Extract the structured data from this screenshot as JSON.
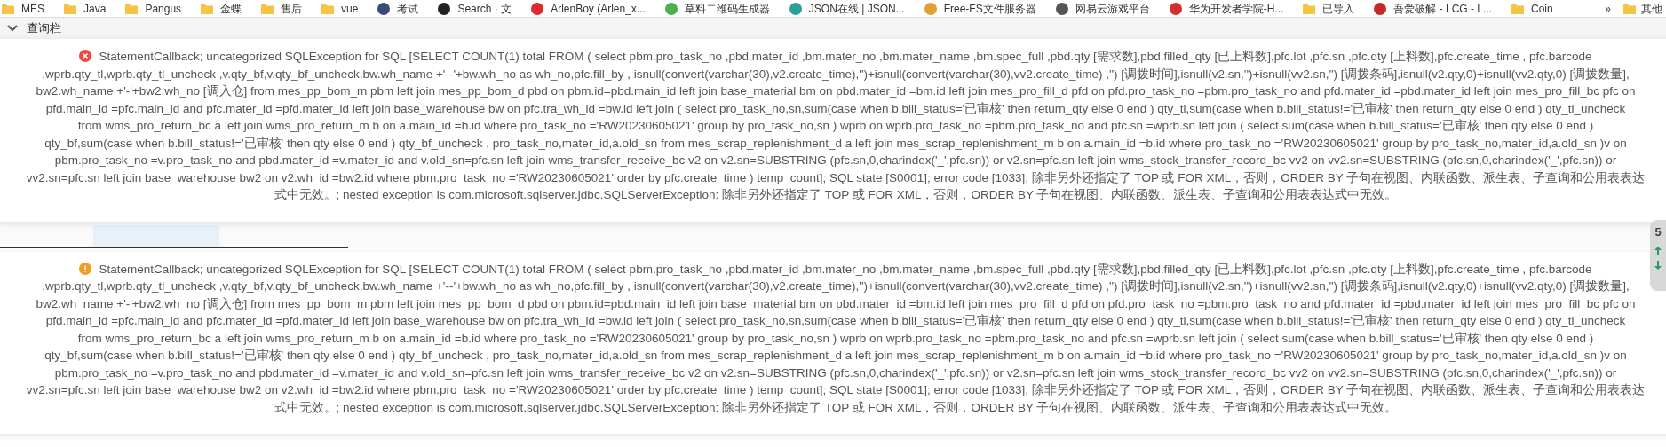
{
  "bookmarks": [
    {
      "label": "MES",
      "kind": "folder"
    },
    {
      "label": "Java",
      "kind": "folder"
    },
    {
      "label": "Pangus",
      "kind": "folder"
    },
    {
      "label": "金蝶",
      "kind": "folder"
    },
    {
      "label": "售后",
      "kind": "folder"
    },
    {
      "label": "vue",
      "kind": "folder"
    },
    {
      "label": "考试",
      "kind": "site",
      "color": "#3b4a7a"
    },
    {
      "label": "Search · 文",
      "kind": "github"
    },
    {
      "label": "ArlenBoy (Arlen_x...",
      "kind": "site",
      "color": "#e0282e"
    },
    {
      "label": "草料二维码生成器",
      "kind": "site",
      "color": "#4caf50"
    },
    {
      "label": "JSON在线 | JSON...",
      "kind": "site",
      "color": "#2aa198"
    },
    {
      "label": "Free-FS文件服务器",
      "kind": "site",
      "color": "#e0a030"
    },
    {
      "label": "网易云游戏平台",
      "kind": "site",
      "color": "#555555"
    },
    {
      "label": "华为开发者学院-H...",
      "kind": "site",
      "color": "#d32f2f"
    },
    {
      "label": "已导入",
      "kind": "folder"
    },
    {
      "label": "吾爱破解 - LCG - L...",
      "kind": "site",
      "color": "#c62828"
    },
    {
      "label": "Coin",
      "kind": "folder"
    }
  ],
  "bookmarks_more": "»",
  "other_bookmarks": "其他",
  "panel": {
    "title": "查询栏",
    "expanded": true
  },
  "messages": [
    {
      "kind": "error",
      "lines": [
        "StatementCallback; uncategorized SQLException for SQL [SELECT COUNT(1) total FROM ( select pbm.pro_task_no ,pbd.mater_id ,bm.mater_no ,bm.mater_name ,bm.spec_full ,pbd.qty [需求数],pbd.filled_qty [已上料数],pfc.lot ,pfc.sn ,pfc.qty [上料数],pfc.create_time , pfc.barcode",
        ",wprb.qty_tl,wprb.qty_tl_uncheck ,v.qty_bf,v.qty_bf_uncheck,bw.wh_name +'--'+bw.wh_no as wh_no,pfc.fill_by , isnull(convert(varchar(30),v2.create_time),'')+isnull(convert(varchar(30),vv2.create_time) ,'') [调拨时间],isnull(v2.sn,'')+isnull(vv2.sn,'') [调拨条码],isnull(v2.qty,0)+isnull(vv2.qty,0) [调拨数量],",
        "bw2.wh_name +'-'+bw2.wh_no [调入仓] from mes_pp_bom_m pbm left join mes_pp_bom_d pbd on pbm.id=pbd.main_id left join base_material bm on pbd.mater_id =bm.id left join mes_pro_fill_d pfd on pfd.pro_task_no =pbm.pro_task_no and pfd.mater_id =pbd.mater_id left join mes_pro_fill_bc pfc on",
        "pfd.main_id =pfc.main_id and pfc.mater_id =pfd.mater_id left join base_warehouse bw on pfc.tra_wh_id =bw.id left join ( select pro_task_no,sn,sum(case when b.bill_status='已审核' then return_qty else 0 end ) qty_tl,sum(case when b.bill_status!='已审核' then return_qty else 0 end ) qty_tl_uncheck",
        "from wms_pro_return_bc a left join wms_pro_return_m b on a.main_id =b.id where pro_task_no ='RW20230605021' group by pro_task_no,sn ) wprb on wprb.pro_task_no =pbm.pro_task_no and pfc.sn =wprb.sn left join ( select sum(case when b.bill_status='已审核' then qty else 0 end )",
        "qty_bf,sum(case when b.bill_status!='已审核' then qty else 0 end ) qty_bf_uncheck , pro_task_no,mater_id,a.old_sn from mes_scrap_replenishment_d a left join mes_scrap_replenishment_m b on a.main_id =b.id where pro_task_no ='RW20230605021' group by pro_task_no,mater_id,a.old_sn )v on",
        "pbm.pro_task_no =v.pro_task_no and pbd.mater_id =v.mater_id and v.old_sn=pfc.sn left join wms_transfer_receive_bc v2 on v2.sn=SUBSTRING (pfc.sn,0,charindex('_',pfc.sn)) or v2.sn=pfc.sn left join wms_stock_transfer_record_bc vv2 on vv2.sn=SUBSTRING (pfc.sn,0,charindex('_',pfc.sn)) or",
        "vv2.sn=pfc.sn left join base_warehouse bw2 on v2.wh_id =bw2.id where pbm.pro_task_no ='RW20230605021' order by pfc.create_time ) temp_count]; SQL state [S0001]; error code [1033]; 除非另外还指定了 TOP 或 FOR XML，否则，ORDER BY 子句在视图、内联函数、派生表、子查询和公用表表达",
        "式中无效。; nested exception is com.microsoft.sqlserver.jdbc.SQLServerException: 除非另外还指定了 TOP 或 FOR XML，否则，ORDER BY 子句在视图、内联函数、派生表、子查询和公用表表达式中无效。"
      ]
    },
    {
      "kind": "warning",
      "lines": [
        "StatementCallback; uncategorized SQLException for SQL [SELECT COUNT(1) total FROM ( select pbm.pro_task_no ,pbd.mater_id ,bm.mater_no ,bm.mater_name ,bm.spec_full ,pbd.qty [需求数],pbd.filled_qty [已上料数],pfc.lot ,pfc.sn ,pfc.qty [上料数],pfc.create_time , pfc.barcode",
        ",wprb.qty_tl,wprb.qty_tl_uncheck ,v.qty_bf,v.qty_bf_uncheck,bw.wh_name +'--'+bw.wh_no as wh_no,pfc.fill_by , isnull(convert(varchar(30),v2.create_time),'')+isnull(convert(varchar(30),vv2.create_time) ,'') [调拨时间],isnull(v2.sn,'')+isnull(vv2.sn,'') [调拨条码],isnull(v2.qty,0)+isnull(vv2.qty,0) [调拨数量],",
        "bw2.wh_name +'-'+bw2.wh_no [调入仓] from mes_pp_bom_m pbm left join mes_pp_bom_d pbd on pbm.id=pbd.main_id left join base_material bm on pbd.mater_id =bm.id left join mes_pro_fill_d pfd on pfd.pro_task_no =pbm.pro_task_no and pfd.mater_id =pbd.mater_id left join mes_pro_fill_bc pfc on",
        "pfd.main_id =pfc.main_id and pfc.mater_id =pfd.mater_id left join base_warehouse bw on pfc.tra_wh_id =bw.id left join ( select pro_task_no,sn,sum(case when b.bill_status='已审核' then return_qty else 0 end ) qty_tl,sum(case when b.bill_status!='已审核' then return_qty else 0 end ) qty_tl_uncheck",
        "from wms_pro_return_bc a left join wms_pro_return_m b on a.main_id =b.id where pro_task_no ='RW20230605021' group by pro_task_no,sn ) wprb on wprb.pro_task_no =pbm.pro_task_no and pfc.sn =wprb.sn left join ( select sum(case when b.bill_status='已审核' then qty else 0 end )",
        "qty_bf,sum(case when b.bill_status!='已审核' then qty else 0 end ) qty_bf_uncheck , pro_task_no,mater_id,a.old_sn from mes_scrap_replenishment_d a left join mes_scrap_replenishment_m b on a.main_id =b.id where pro_task_no ='RW20230605021' group by pro_task_no,mater_id,a.old_sn )v on",
        "pbm.pro_task_no =v.pro_task_no and pbd.mater_id =v.mater_id and v.old_sn=pfc.sn left join wms_transfer_receive_bc v2 on v2.sn=SUBSTRING (pfc.sn,0,charindex('_',pfc.sn)) or v2.sn=pfc.sn left join wms_stock_transfer_record_bc vv2 on vv2.sn=SUBSTRING (pfc.sn,0,charindex('_',pfc.sn)) or",
        "vv2.sn=pfc.sn left join base_warehouse bw2 on v2.wh_id =bw2.id where pbm.pro_task_no ='RW20230605021' order by pfc.create_time ) temp_count]; SQL state [S0001]; error code [1033]; 除非另外还指定了 TOP 或 FOR XML，否则，ORDER BY 子句在视图、内联函数、派生表、子查询和公用表表达",
        "式中无效。; nested exception is com.microsoft.sqlserver.jdbc.SQLServerException: 除非另外还指定了 TOP 或 FOR XML，否则，ORDER BY 子句在视图、内联函数、派生表、子查询和公用表表达式中无效。"
      ]
    }
  ],
  "side_widget": {
    "label": "5"
  }
}
